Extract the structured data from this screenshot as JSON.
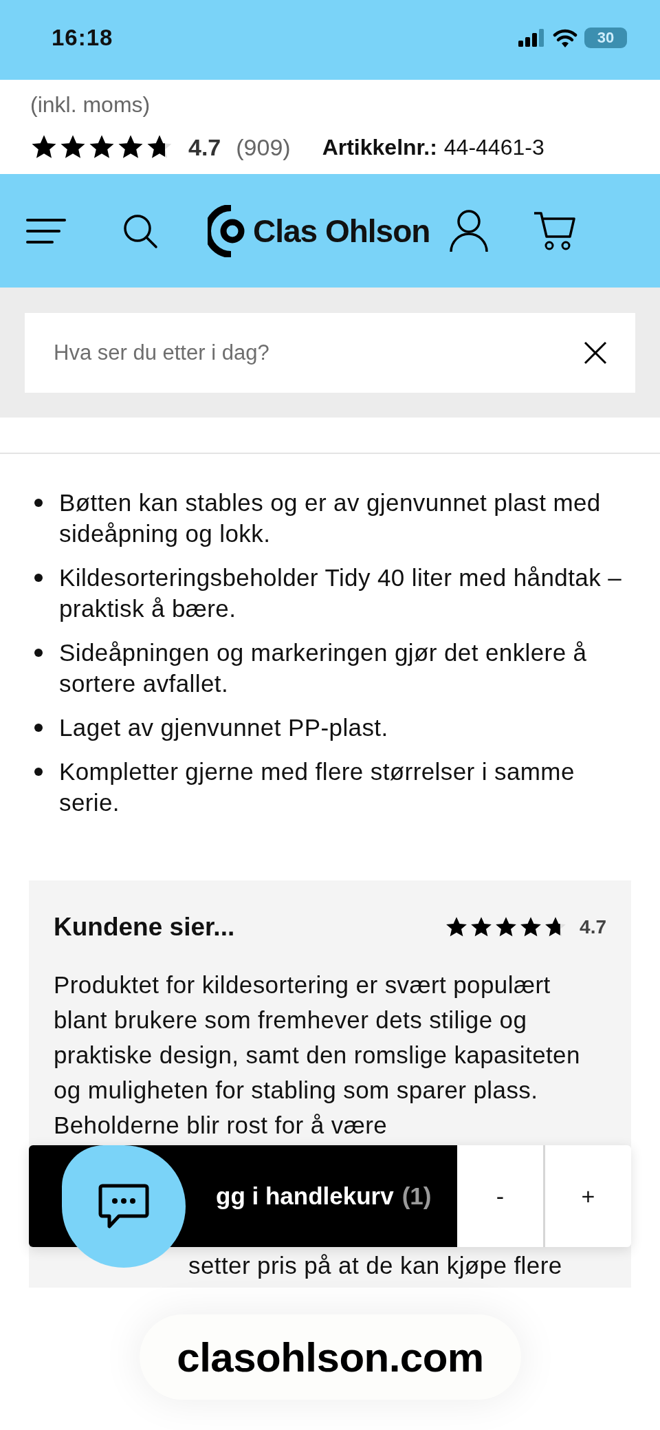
{
  "status_bar": {
    "time": "16:18",
    "battery": "30"
  },
  "product": {
    "price_note": "(inkl. moms)",
    "rating": {
      "stars": 4.7,
      "score": "4.7",
      "count": "(909)"
    },
    "article": {
      "label": "Artikkelnr.:",
      "value": "44-4461-3"
    }
  },
  "header": {
    "logo": "Clas Ohlson"
  },
  "search": {
    "placeholder": "Hva ser du etter i dag?"
  },
  "features": [
    "Bøtten kan stables og er av gjenvunnet plast med sideåpning og lokk.",
    "Kildesorteringsbeholder Tidy 40 liter med håndtak – praktisk å bære.",
    "Sideåpningen og markeringen gjør det enklere å sortere avfallet.",
    "Laget av gjenvunnet PP-plast.",
    "Kompletter gjerne med flere størrelser i samme serie."
  ],
  "reviews": {
    "title": "Kundene sier...",
    "stars": 4.7,
    "score": "4.7",
    "summary": "Produktet for kildesortering er svært populært blant brukere som fremhever dets stilige og praktiske design, samt den romslige kapasiteten og muligheten for stabling som sparer plass. Beholderne blir rost for å være",
    "summary_continued": "setter pris på at de kan kjøpe flere"
  },
  "cart_bar": {
    "label": "gg i handlekurv",
    "quantity": "(1)",
    "decrease": "-",
    "increase": "+"
  },
  "url_bar": {
    "url": "clasohlson.com"
  }
}
